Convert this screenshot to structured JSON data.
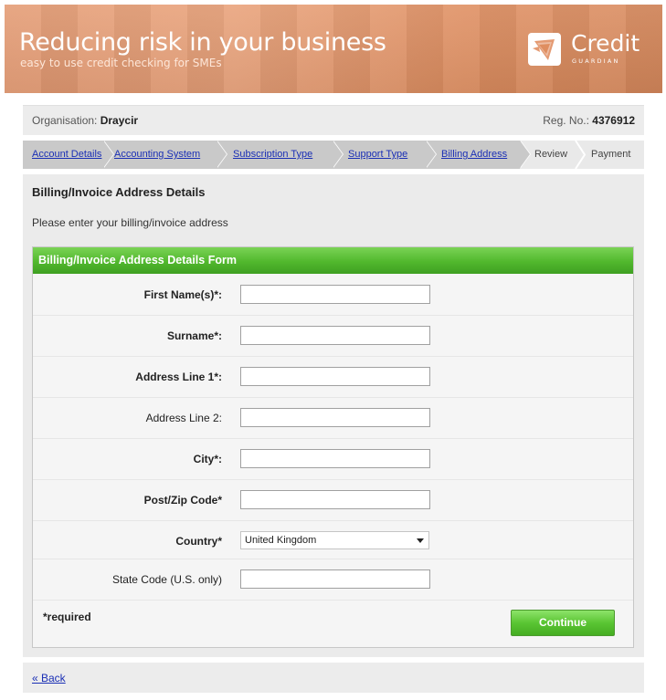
{
  "banner": {
    "title": "Reducing risk in your business",
    "subtitle": "easy to use credit checking for SMEs",
    "logo_text": "Credit",
    "logo_sub": "GUARDIAN"
  },
  "org": {
    "org_label": "Organisation:",
    "org_name": "Draycir",
    "reg_label": "Reg. No.:",
    "reg_number": "4376912"
  },
  "steps": [
    {
      "label": "Account Details",
      "link": true
    },
    {
      "label": "Accounting System",
      "link": true
    },
    {
      "label": "Subscription Type",
      "link": true
    },
    {
      "label": "Support Type",
      "link": true
    },
    {
      "label": "Billing Address",
      "link": true
    },
    {
      "label": "Review",
      "link": false
    },
    {
      "label": "Payment",
      "link": false
    }
  ],
  "main": {
    "title": "Billing/Invoice Address Details",
    "intro": "Please enter your billing/invoice address"
  },
  "form": {
    "header": "Billing/Invoice Address Details Form",
    "fields": [
      {
        "label": "First Name(s)*:",
        "value": ""
      },
      {
        "label": "Surname*:",
        "value": ""
      },
      {
        "label": "Address Line 1*:",
        "value": ""
      },
      {
        "label": "Address Line 2:",
        "value": ""
      },
      {
        "label": "City*:",
        "value": ""
      },
      {
        "label": "Post/Zip Code*",
        "value": ""
      },
      {
        "label": "Country*",
        "value": "United Kingdom"
      },
      {
        "label": "State Code (U.S. only)",
        "value": ""
      }
    ],
    "required_note": "*required",
    "continue_label": "Continue"
  },
  "back": {
    "label": "« Back"
  },
  "colors": {
    "accent_green": "#51b82d",
    "link_blue": "#1a2fb5",
    "banner_orange": "#e49a72"
  }
}
